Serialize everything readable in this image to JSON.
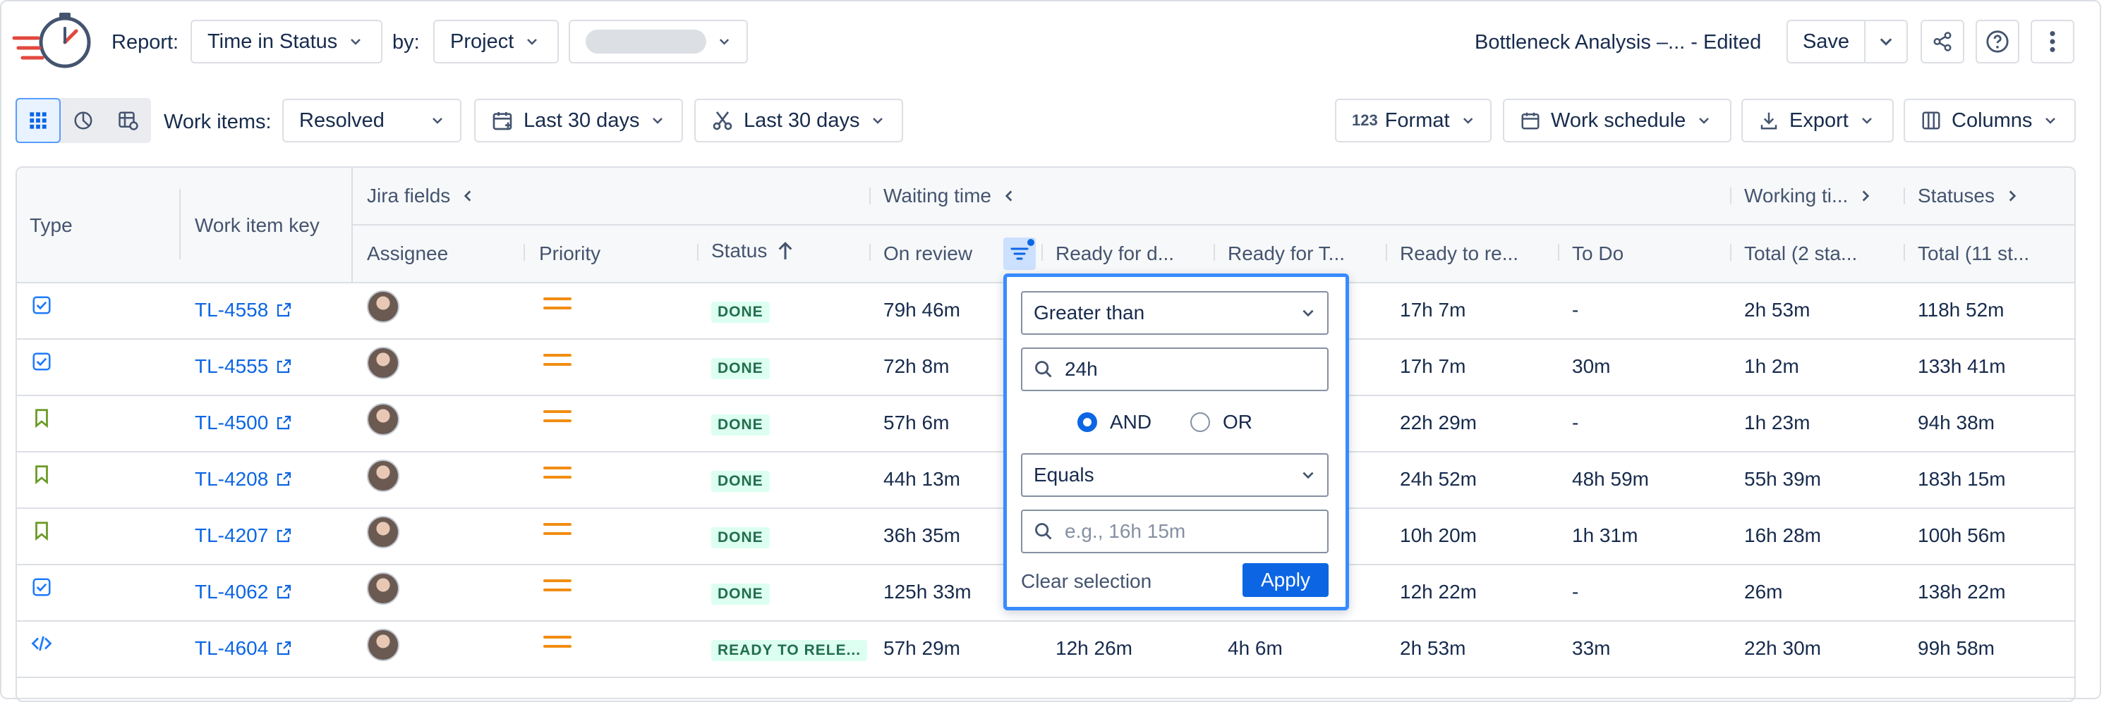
{
  "toolbar": {
    "report_label": "Report:",
    "report_value": "Time in Status",
    "by_label": "by:",
    "by_value": "Project",
    "report_title": "Bottleneck Analysis –... - Edited",
    "save_label": "Save"
  },
  "filters": {
    "work_items_label": "Work items:",
    "work_items_value": "Resolved",
    "date_range_1": "Last 30 days",
    "date_range_2": "Last 30 days",
    "format_label": "Format",
    "work_schedule_label": "Work schedule",
    "export_label": "Export",
    "columns_label": "Columns"
  },
  "table": {
    "groups": {
      "jira_fields": "Jira fields",
      "waiting_time": "Waiting time",
      "working_time": "Working ti...",
      "statuses": "Statuses"
    },
    "headers": {
      "type": "Type",
      "work_item_key": "Work item key",
      "assignee": "Assignee",
      "priority": "Priority",
      "status": "Status",
      "on_review": "On review",
      "ready_for_dev": "Ready for d...",
      "ready_for_test": "Ready for T...",
      "ready_to_release": "Ready to re...",
      "to_do": "To Do",
      "total_working": "Total (2 sta...",
      "total_statuses": "Total (11 st..."
    },
    "rows": [
      {
        "type": "task",
        "key": "TL-4558",
        "status": "DONE",
        "on_review": "79h 46m",
        "ready_for_dev": "",
        "ready_for_test": "",
        "ready_to_release": "17h 7m",
        "to_do": "-",
        "total_working": "2h 53m",
        "total_statuses": "118h 52m"
      },
      {
        "type": "task",
        "key": "TL-4555",
        "status": "DONE",
        "on_review": "72h 8m",
        "ready_for_dev": "",
        "ready_for_test": "",
        "ready_to_release": "17h 7m",
        "to_do": "30m",
        "total_working": "1h 2m",
        "total_statuses": "133h 41m"
      },
      {
        "type": "story",
        "key": "TL-4500",
        "status": "DONE",
        "on_review": "57h 6m",
        "ready_for_dev": "",
        "ready_for_test": "",
        "ready_to_release": "22h 29m",
        "to_do": "-",
        "total_working": "1h 23m",
        "total_statuses": "94h 38m"
      },
      {
        "type": "story",
        "key": "TL-4208",
        "status": "DONE",
        "on_review": "44h 13m",
        "ready_for_dev": "",
        "ready_for_test": "",
        "ready_to_release": "24h 52m",
        "to_do": "48h 59m",
        "total_working": "55h 39m",
        "total_statuses": "183h 15m"
      },
      {
        "type": "story",
        "key": "TL-4207",
        "status": "DONE",
        "on_review": "36h 35m",
        "ready_for_dev": "",
        "ready_for_test": "",
        "ready_to_release": "10h 20m",
        "to_do": "1h 31m",
        "total_working": "16h 28m",
        "total_statuses": "100h 56m"
      },
      {
        "type": "task",
        "key": "TL-4062",
        "status": "DONE",
        "on_review": "125h 33m",
        "ready_for_dev": "",
        "ready_for_test": "",
        "ready_to_release": "12h 22m",
        "to_do": "-",
        "total_working": "26m",
        "total_statuses": "138h 22m"
      },
      {
        "type": "code",
        "key": "TL-4604",
        "status": "READY TO RELE...",
        "on_review": "57h 29m",
        "ready_for_dev": "12h 26m",
        "ready_for_test": "4h 6m",
        "ready_to_release": "2h 53m",
        "to_do": "33m",
        "total_working": "22h 30m",
        "total_statuses": "99h 58m"
      }
    ]
  },
  "filter_popup": {
    "condition_1": "Greater than",
    "value_1": "24h",
    "and_label": "AND",
    "or_label": "OR",
    "logic_selected": "AND",
    "condition_2": "Equals",
    "value_2_placeholder": "e.g., 16h 15m",
    "clear_label": "Clear selection",
    "apply_label": "Apply"
  },
  "colors": {
    "accent": "#0c66e4",
    "done_badge_bg": "#dcfff1",
    "done_badge_text": "#216e4e",
    "priority_medium": "#f18d13",
    "task_icon": "#1d7afc",
    "story_icon": "#6a9a23"
  }
}
